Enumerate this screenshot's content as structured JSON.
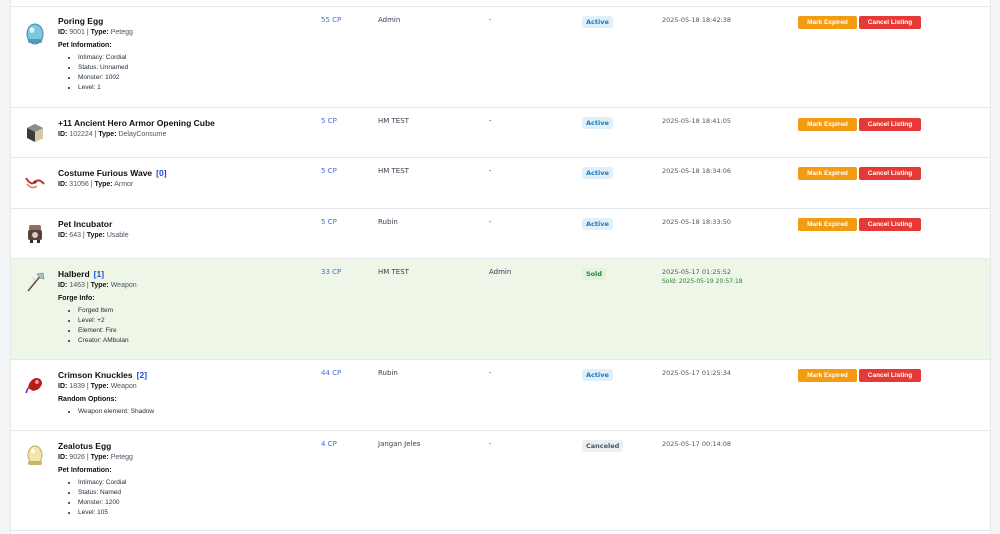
{
  "actions": {
    "expire_label": "Mark Expired",
    "cancel_label": "Cancel Listing"
  },
  "rows": [
    {
      "name": "Poring Egg",
      "slots": "",
      "id_label": "ID:",
      "id": "9001",
      "type_label": "Type:",
      "type": "Petegg",
      "section": "Pet Information:",
      "details": [
        "Intimacy: Cordial",
        "Status: Unnamed",
        "Monster: 1002",
        "Level: 1"
      ],
      "price": "55 CP",
      "seller": "Admin",
      "buyer": "-",
      "status": "Active",
      "date": "2025-05-18 18:42:38",
      "sold_at": "",
      "icon": "poring-egg-icon"
    },
    {
      "name": "+11 Ancient Hero Armor Opening Cube",
      "slots": "",
      "id_label": "ID:",
      "id": "102224",
      "type_label": "Type:",
      "type": "DelayConsume",
      "section": "",
      "details": [],
      "price": "5 CP",
      "seller": "HM TEST",
      "buyer": "-",
      "status": "Active",
      "date": "2025-05-18 18:41:05",
      "sold_at": "",
      "icon": "cube-box-icon"
    },
    {
      "name": "Costume Furious Wave",
      "slots": "[0]",
      "id_label": "ID:",
      "id": "31056",
      "type_label": "Type:",
      "type": "Armor",
      "section": "",
      "details": [],
      "price": "5 CP",
      "seller": "HM TEST",
      "buyer": "-",
      "status": "Active",
      "date": "2025-05-18 18:34:06",
      "sold_at": "",
      "icon": "wave-costume-icon"
    },
    {
      "name": "Pet Incubator",
      "slots": "",
      "id_label": "ID:",
      "id": "643",
      "type_label": "Type:",
      "type": "Usable",
      "section": "",
      "details": [],
      "price": "5 CP",
      "seller": "Rubin",
      "buyer": "-",
      "status": "Active",
      "date": "2025-05-18 18:33:50",
      "sold_at": "",
      "icon": "incubator-icon"
    },
    {
      "name": "Halberd",
      "slots": "[1]",
      "id_label": "ID:",
      "id": "1463",
      "type_label": "Type:",
      "type": "Weapon",
      "section": "Forge Info:",
      "details": [
        "Forged Item",
        "Level: +2",
        "Element: Fire",
        "Creator: AMbulan"
      ],
      "price": "33 CP",
      "seller": "HM TEST",
      "buyer": "Admin",
      "status": "Sold",
      "date": "2025-05-17 01:25:52",
      "sold_at": "Sold: 2025-05-19 20:57:18",
      "icon": "halberd-icon"
    },
    {
      "name": "Crimson Knuckles",
      "slots": "[2]",
      "id_label": "ID:",
      "id": "1839",
      "type_label": "Type:",
      "type": "Weapon",
      "section": "Random Options:",
      "details": [
        "Weapon element: Shadow"
      ],
      "price": "44 CP",
      "seller": "Rubin",
      "buyer": "-",
      "status": "Active",
      "date": "2025-05-17 01:25:34",
      "sold_at": "",
      "icon": "knuckles-icon"
    },
    {
      "name": "Zealotus Egg",
      "slots": "",
      "id_label": "ID:",
      "id": "9026",
      "type_label": "Type:",
      "type": "Petegg",
      "section": "Pet Information:",
      "details": [
        "Intimacy: Cordial",
        "Status: Named",
        "Monster: 1200",
        "Level: 105"
      ],
      "price": "4 CP",
      "seller": "Jangan Jeles",
      "buyer": "-",
      "status": "Canceled",
      "date": "2025-05-17 00:14:08",
      "sold_at": "",
      "icon": "zealotus-egg-icon"
    }
  ]
}
